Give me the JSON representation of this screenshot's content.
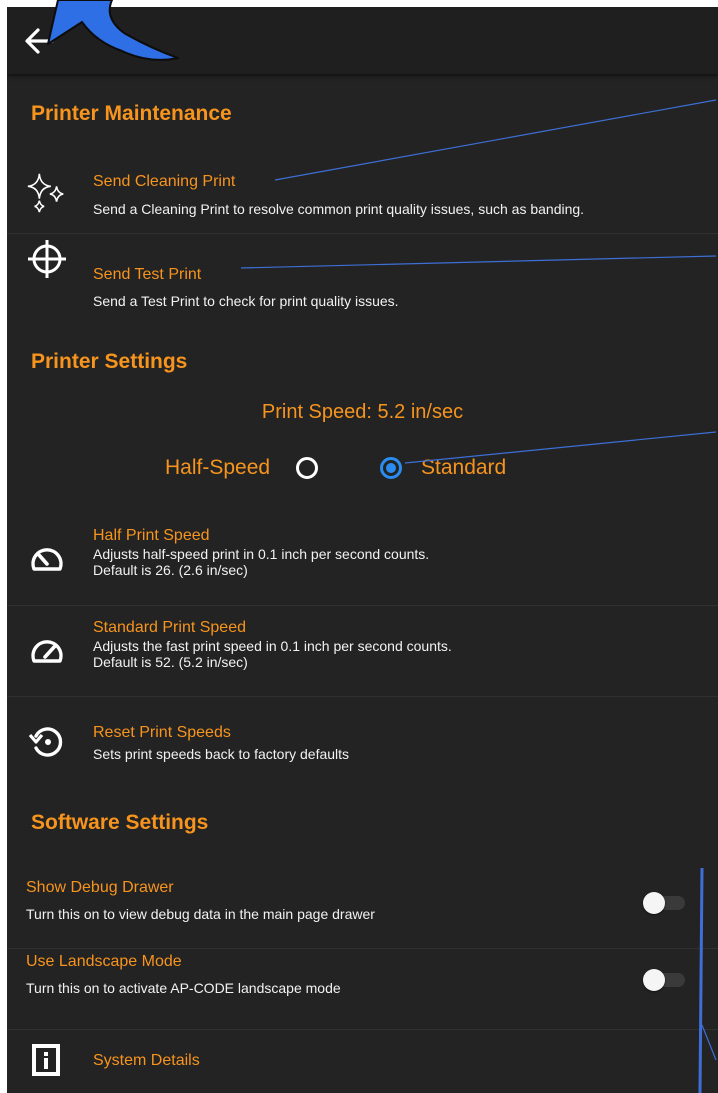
{
  "colors": {
    "accent": "#f7941d",
    "radio_selected": "#2b8cf0",
    "background": "#232323",
    "appbar": "#1f1f1f",
    "annotation": "#3d6fd6"
  },
  "appbar": {
    "back_icon": "arrow-left-icon"
  },
  "printer_maintenance": {
    "title": "Printer Maintenance",
    "items": [
      {
        "icon": "sparkle-icon",
        "title": "Send Cleaning Print",
        "desc": "Send a Cleaning Print to resolve common print quality issues, such as banding."
      },
      {
        "icon": "crosshair-icon",
        "title": "Send Test Print",
        "desc": "Send a Test Print to check for print quality issues."
      }
    ]
  },
  "printer_settings": {
    "title": "Printer Settings",
    "speed_label": "Print Speed: 5.2 in/sec",
    "radio_half_label": "Half-Speed",
    "radio_standard_label": "Standard",
    "selected": "Standard",
    "items": [
      {
        "icon": "speedometer-slow-icon",
        "title": "Half Print Speed",
        "desc1": "Adjusts half-speed print in 0.1 inch per second counts.",
        "desc2": "Default is 26. (2.6 in/sec)"
      },
      {
        "icon": "speedometer-fast-icon",
        "title": "Standard Print Speed",
        "desc1": "Adjusts the fast print speed in 0.1 inch per second counts.",
        "desc2": "Default is 52. (5.2 in/sec)"
      },
      {
        "icon": "reset-icon",
        "title": "Reset Print Speeds",
        "desc": "Sets print speeds back to factory defaults"
      }
    ]
  },
  "software_settings": {
    "title": "Software Settings",
    "items": [
      {
        "title": "Show Debug Drawer",
        "desc": "Turn this on to view debug data in the main page drawer",
        "enabled": false
      },
      {
        "title": "Use Landscape Mode",
        "desc": "Turn this on to activate AP-CODE landscape mode",
        "enabled": false
      },
      {
        "icon": "info-icon",
        "title": "System Details"
      }
    ]
  }
}
